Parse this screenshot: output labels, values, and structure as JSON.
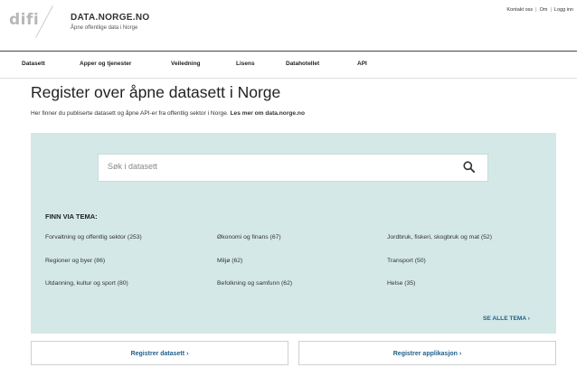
{
  "header": {
    "logo_text": "difi",
    "site_title": "DATA.NORGE.NO",
    "site_subtitle": "Åpne offentlige data i Norge",
    "top_links": [
      "Kontakt oss",
      "Om",
      "Logg inn"
    ]
  },
  "nav": {
    "items": [
      "Datasett",
      "Apper og tjenester",
      "Veiledning",
      "Lisens",
      "Datahotellet",
      "API"
    ]
  },
  "page": {
    "title": "Register over åpne datasett i Norge",
    "intro_text": "Her finner du publiserte datasett og åpne API-er fra offentlig sektor i Norge. ",
    "intro_link": "Les mer om data.norge.no"
  },
  "search": {
    "placeholder": "Søk i datasett",
    "icon": "search-icon"
  },
  "themes": {
    "heading": "FINN VIA TEMA:",
    "items": [
      "Forvaltning og offentlig sektor (253)",
      "Økonomi og finans (67)",
      "Jordbruk, fiskeri, skogbruk og mat (52)",
      "Regioner og byer (86)",
      "Miljø (62)",
      "Transport (50)",
      "Utdanning, kultur og sport (80)",
      "Befolkning og samfunn (62)",
      "Helse (35)"
    ],
    "see_all": "SE ALLE TEMA",
    "see_all_arrow": "›"
  },
  "actions": {
    "register_dataset": "Registrer datasett",
    "register_app": "Registrer applikasjon",
    "arrow": "›"
  },
  "colors": {
    "panel_bg": "#d5e8e8",
    "link_blue": "#1f5f8b",
    "logo_gray": "#b7b7b7"
  }
}
